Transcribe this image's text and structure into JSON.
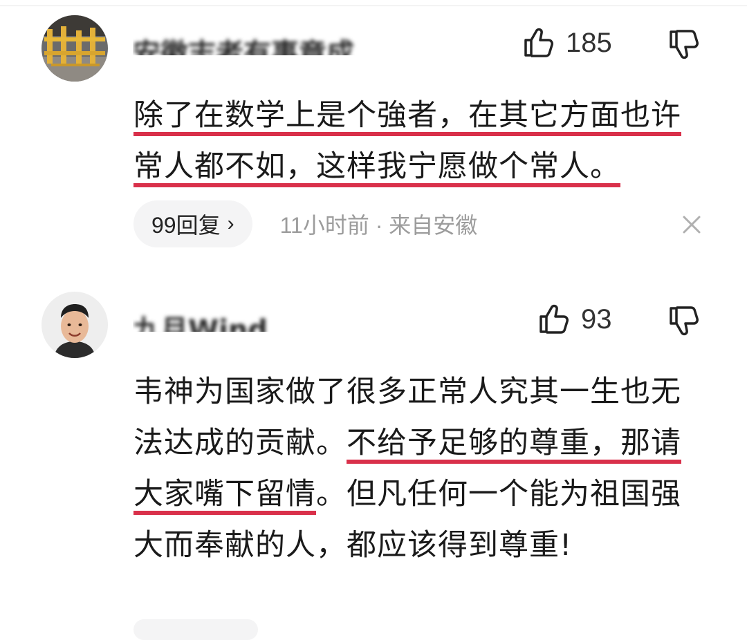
{
  "comments": [
    {
      "username": "安徽志者有事竟成",
      "likes": "185",
      "text": {
        "part1": "除了在数学上是个強者，在其它方面也许常人都不如，这样我宁愿做个常人。"
      },
      "reply_label": "99回复",
      "reply_chevron": "›",
      "meta": "11小时前 · 来自安徽",
      "close_icon": "close-icon"
    },
    {
      "username": "九月Wind",
      "likes": "93",
      "text": {
        "part1": "韦神为国家做了很多正常人究其一生也无法达成的贡献。",
        "part2": "不给予足够的尊重，",
        "part3": "那请大家嘴下留情",
        "part4": "。但凡任何一个能为祖国强大而奉献的人，都应该得到尊重!"
      }
    }
  ],
  "icons": {
    "like": "thumbs-up-icon",
    "dislike": "thumbs-down-icon"
  },
  "colors": {
    "highlight_underline": "#d9304a",
    "meta_gray": "#9c9c9c",
    "pill_bg": "#f4f4f5"
  }
}
